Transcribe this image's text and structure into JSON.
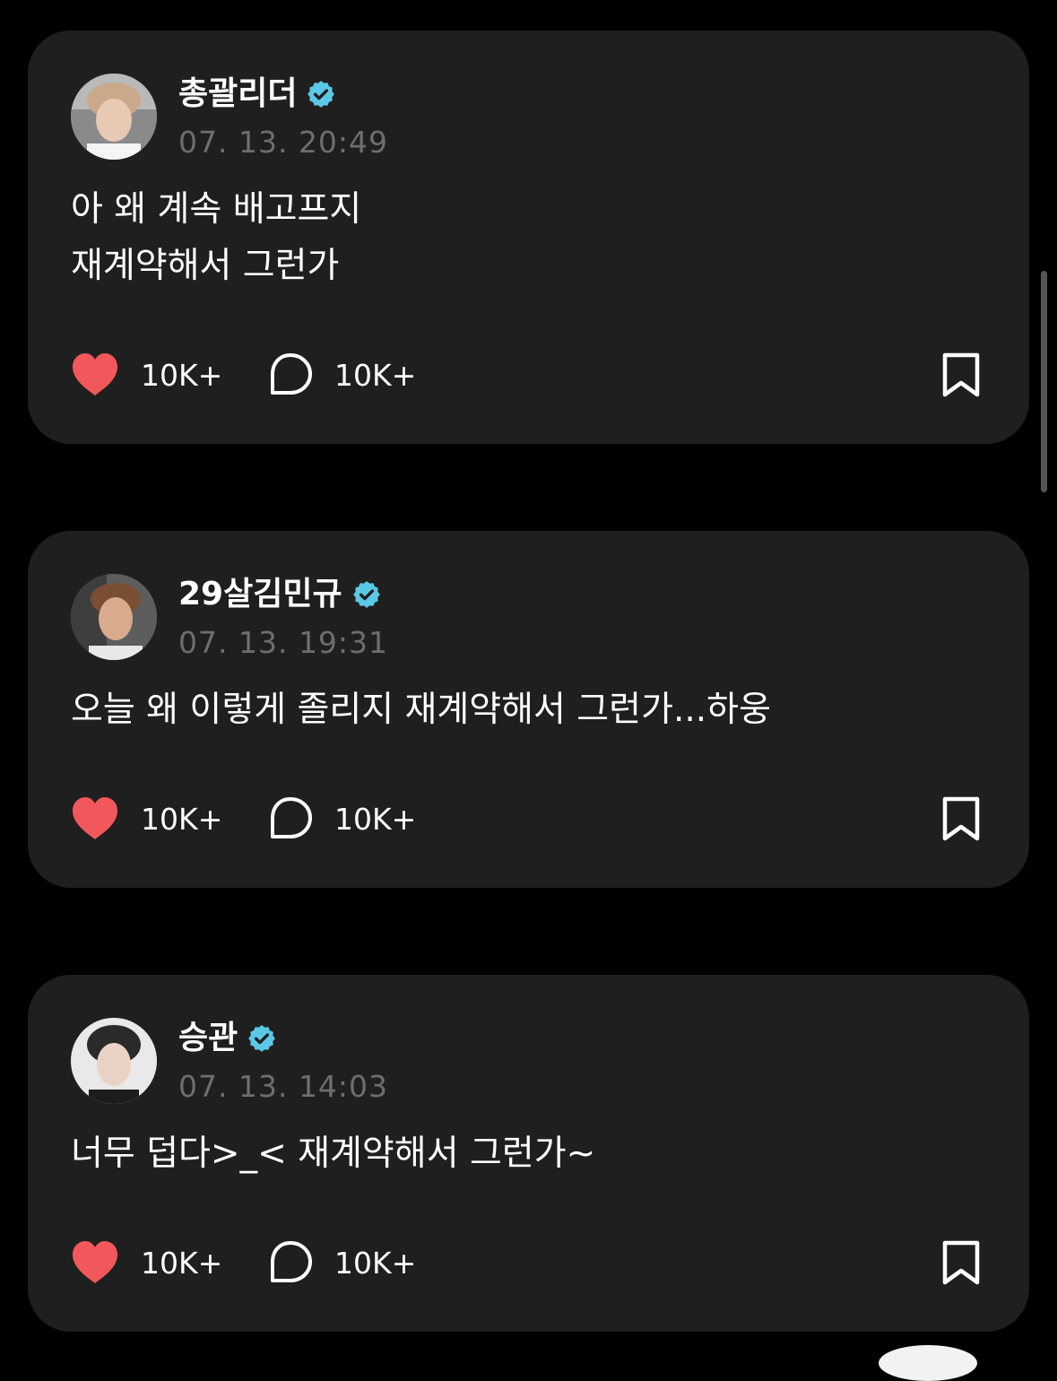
{
  "colors": {
    "background": "#000000",
    "card": "#1f1f1f",
    "heart": "#f2585b",
    "verified": "#5bc8e6",
    "timestamp": "#6e6e6e"
  },
  "icons": {
    "like": "heart-icon",
    "comment": "comment-bubble-icon",
    "bookmark": "bookmark-icon",
    "verified": "verified-badge-icon"
  },
  "posts": [
    {
      "username": "총괄리더",
      "verified": true,
      "timestamp": "07. 13. 20:49",
      "text": "아 왜 계속 배고프지\n재계약해서 그런가",
      "likes": "10K+",
      "comments": "10K+",
      "liked": true
    },
    {
      "username": "29살김민규",
      "verified": true,
      "timestamp": "07. 13. 19:31",
      "text": "오늘 왜 이렇게 졸리지 재계약해서 그런가...하웅",
      "likes": "10K+",
      "comments": "10K+",
      "liked": true
    },
    {
      "username": "승관",
      "verified": true,
      "timestamp": "07. 13. 14:03",
      "text": "너무 덥다>_< 재계약해서 그런가~",
      "likes": "10K+",
      "comments": "10K+",
      "liked": true
    }
  ]
}
